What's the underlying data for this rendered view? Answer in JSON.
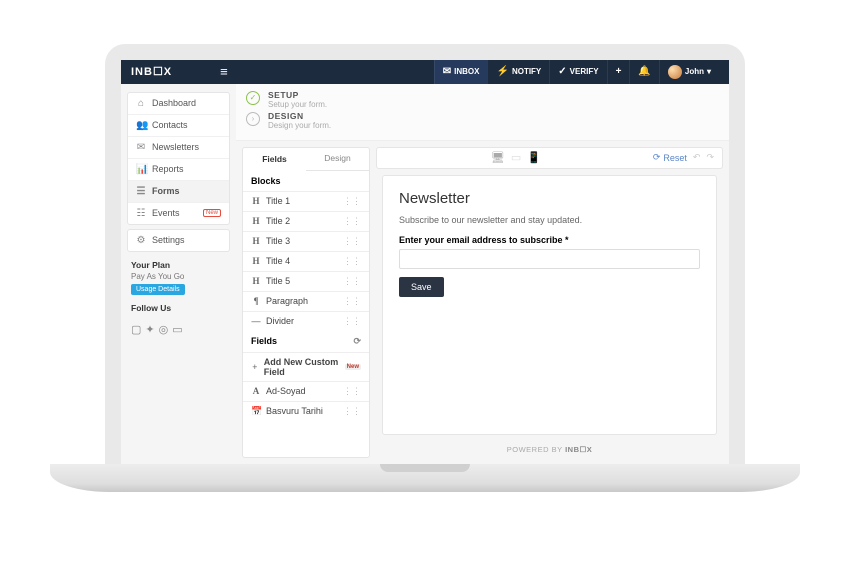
{
  "topbar": {
    "logo_text": "INB☐X",
    "nav": {
      "inbox": "INBOX",
      "notify": "NOTIFY",
      "verify": "VERIFY"
    },
    "user_name": "John",
    "user_caret": "▾"
  },
  "sidebar": {
    "items": [
      {
        "icon": "⌂",
        "label": "Dashboard"
      },
      {
        "icon": "👥",
        "label": "Contacts"
      },
      {
        "icon": "✉",
        "label": "Newsletters"
      },
      {
        "icon": "📊",
        "label": "Reports"
      },
      {
        "icon": "☰",
        "label": "Forms"
      },
      {
        "icon": "☷",
        "label": "Events",
        "badge": "New"
      }
    ],
    "settings_icon": "⚙",
    "settings_label": "Settings",
    "plan_title": "Your Plan",
    "plan_name": "Pay As You Go",
    "plan_button": "Usage Details",
    "follow_title": "Follow Us"
  },
  "steps": {
    "setup_title": "SETUP",
    "setup_sub": "Setup your form.",
    "design_title": "DESIGN",
    "design_sub": "Design your form."
  },
  "toolbar": {
    "reset_label": "Reset"
  },
  "builder": {
    "tab_fields": "Fields",
    "tab_design": "Design",
    "blocks_title": "Blocks",
    "blocks": [
      {
        "icon": "H",
        "label": "Title 1"
      },
      {
        "icon": "H",
        "label": "Title 2"
      },
      {
        "icon": "H",
        "label": "Title 3"
      },
      {
        "icon": "H",
        "label": "Title 4"
      },
      {
        "icon": "H",
        "label": "Title 5"
      },
      {
        "icon": "¶",
        "label": "Paragraph"
      },
      {
        "icon": "—",
        "label": "Divider"
      }
    ],
    "fields_title": "Fields",
    "add_new_label": "Add New Custom Field",
    "add_new_flag": "New",
    "fields": [
      {
        "icon": "A",
        "label": "Ad-Soyad"
      },
      {
        "icon": "📅",
        "label": "Basvuru Tarihi"
      }
    ]
  },
  "form_preview": {
    "heading": "Newsletter",
    "subtext": "Subscribe to our newsletter and stay updated.",
    "field_label": "Enter your email address to subscribe *",
    "input_value": "",
    "save_label": "Save",
    "powered_prefix": "POWERED BY ",
    "powered_brand": "INB☐X"
  }
}
